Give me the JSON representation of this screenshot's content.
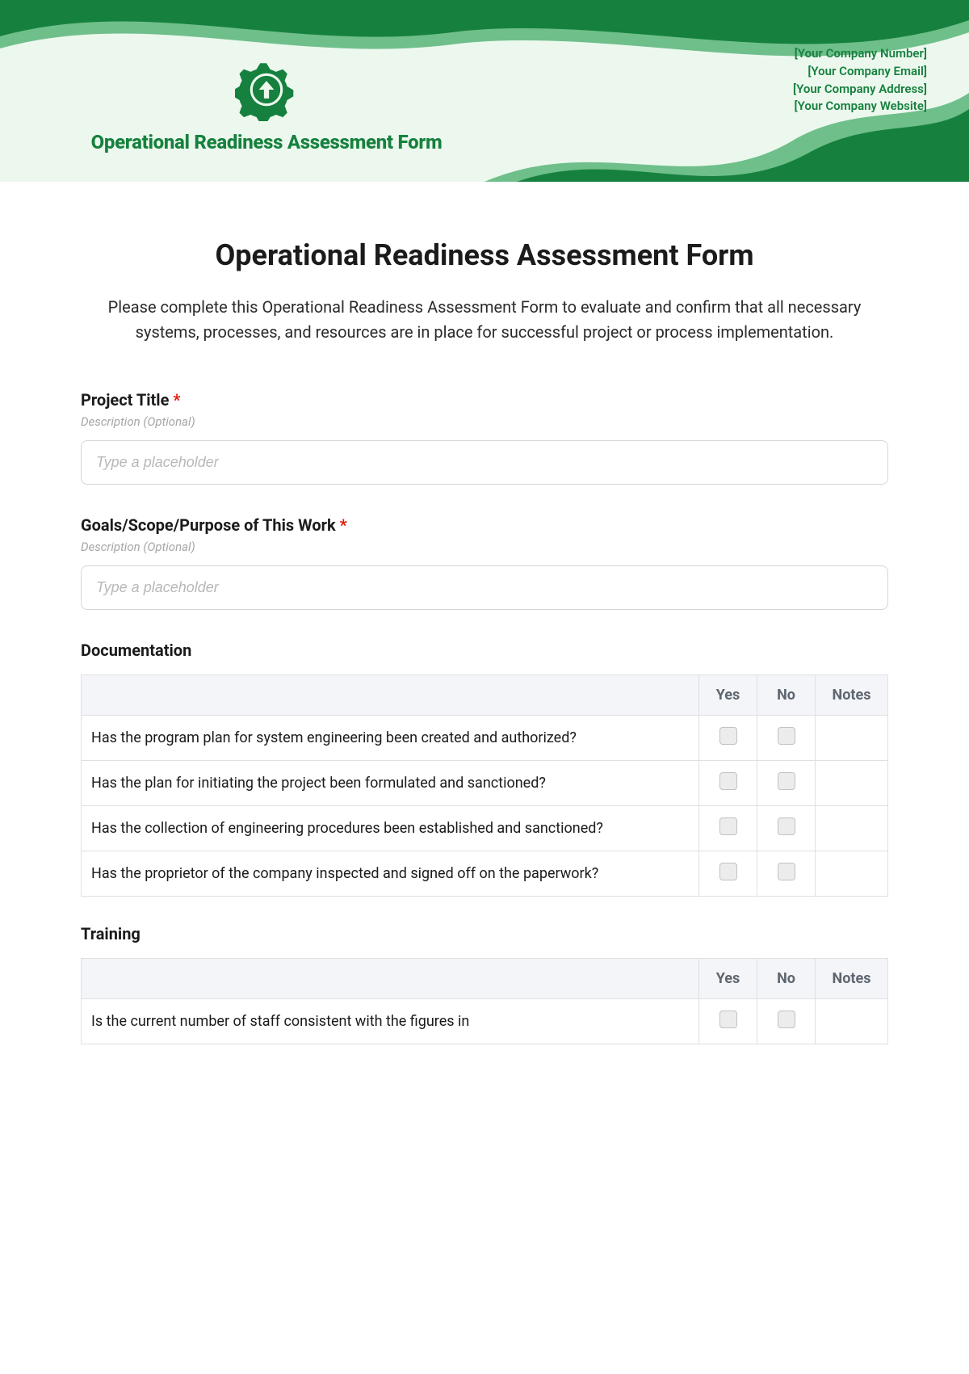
{
  "header": {
    "title": "Operational Readiness Assessment Form",
    "company": {
      "number": "[Your Company Number]",
      "email": "[Your Company Email]",
      "address": "[Your Company Address]",
      "website": "[Your Company Website]"
    }
  },
  "form": {
    "title": "Operational Readiness Assessment Form",
    "description": "Please complete this Operational Readiness Assessment Form to evaluate and confirm that all necessary systems, processes, and resources are in place for successful project or process implementation."
  },
  "fields": {
    "project_title": {
      "label": "Project Title",
      "required": "*",
      "sub": "Description (Optional)",
      "placeholder": "Type a placeholder"
    },
    "goals": {
      "label": "Goals/Scope/Purpose of This Work",
      "required": "*",
      "sub": "Description (Optional)",
      "placeholder": "Type a placeholder"
    }
  },
  "sections": {
    "documentation": {
      "title": "Documentation",
      "cols": {
        "yes": "Yes",
        "no": "No",
        "notes": "Notes"
      },
      "rows": [
        "Has the program plan for system engineering been created and authorized?",
        "Has the plan for initiating the project been formulated and sanctioned?",
        "Has the collection of engineering procedures been established and sanctioned?",
        "Has the proprietor of the company inspected and signed off on the paperwork?"
      ]
    },
    "training": {
      "title": "Training",
      "cols": {
        "yes": "Yes",
        "no": "No",
        "notes": "Notes"
      },
      "rows": [
        "Is the current number of staff consistent with the figures in"
      ]
    }
  }
}
